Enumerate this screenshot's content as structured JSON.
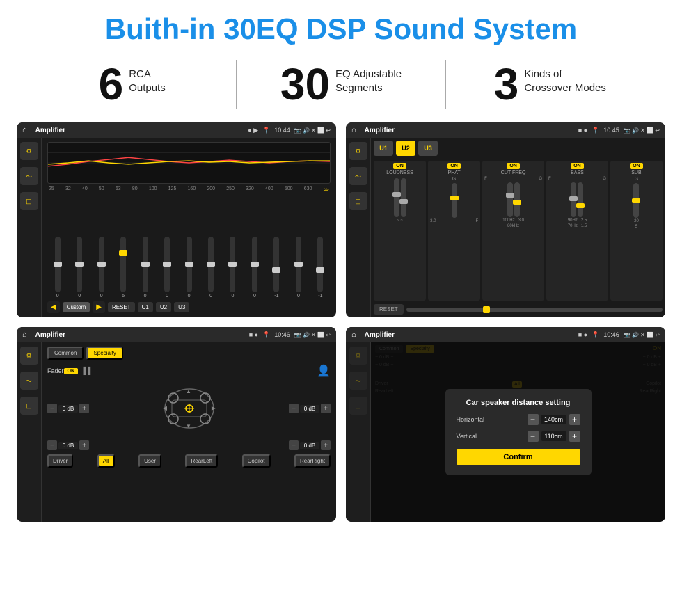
{
  "page": {
    "title": "Buith-in 30EQ DSP Sound System",
    "background": "#ffffff"
  },
  "stats": [
    {
      "number": "6",
      "line1": "RCA",
      "line2": "Outputs"
    },
    {
      "number": "30",
      "line1": "EQ Adjustable",
      "line2": "Segments"
    },
    {
      "number": "3",
      "line1": "Kinds of",
      "line2": "Crossover Modes"
    }
  ],
  "screens": {
    "eq": {
      "title": "Amplifier",
      "time": "10:44",
      "freq_labels": [
        "25",
        "32",
        "40",
        "50",
        "63",
        "80",
        "100",
        "125",
        "160",
        "200",
        "250",
        "320",
        "400",
        "500",
        "630"
      ],
      "slider_values": [
        "0",
        "0",
        "0",
        "5",
        "0",
        "0",
        "0",
        "0",
        "0",
        "0",
        "-1",
        "0",
        "-1"
      ],
      "buttons": [
        "Custom",
        "RESET",
        "U1",
        "U2",
        "U3"
      ]
    },
    "crossover": {
      "title": "Amplifier",
      "time": "10:45",
      "u_buttons": [
        "U1",
        "U2",
        "U3"
      ],
      "modules": [
        {
          "label": "LOUDNESS",
          "toggle": "ON"
        },
        {
          "label": "PHAT",
          "toggle": "ON"
        },
        {
          "label": "CUT FREQ",
          "toggle": "ON"
        },
        {
          "label": "BASS",
          "toggle": "ON"
        },
        {
          "label": "SUB",
          "toggle": "ON"
        }
      ],
      "reset_label": "RESET"
    },
    "fader": {
      "title": "Amplifier",
      "time": "10:46",
      "tabs": [
        "Common",
        "Specialty"
      ],
      "active_tab": "Specialty",
      "fader_label": "Fader",
      "fader_toggle": "ON",
      "db_values": [
        "0 dB",
        "0 dB",
        "0 dB",
        "0 dB"
      ],
      "bottom_buttons": [
        "Driver",
        "All",
        "User",
        "RearLeft",
        "Copilot",
        "RearRight"
      ]
    },
    "dialog": {
      "title": "Amplifier",
      "time": "10:46",
      "tabs": [
        "Common",
        "Specialty"
      ],
      "dialog_title": "Car speaker distance setting",
      "horizontal_label": "Horizontal",
      "horizontal_value": "140cm",
      "vertical_label": "Vertical",
      "vertical_value": "110cm",
      "confirm_label": "Confirm",
      "bottom_buttons": [
        "Driver",
        "RearLeft",
        "Copilot",
        "RearRight"
      ]
    }
  }
}
